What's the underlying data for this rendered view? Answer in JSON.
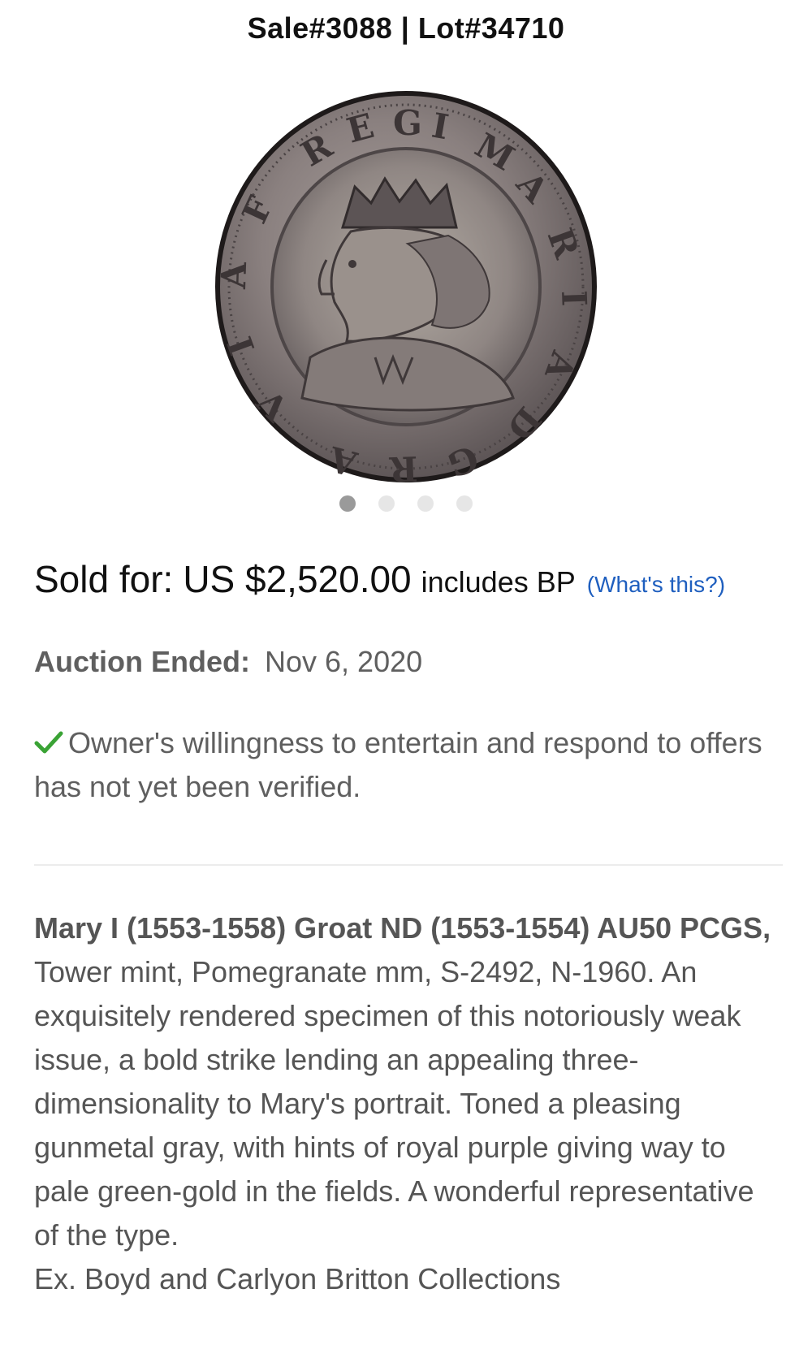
{
  "header": {
    "title": "Sale#3088 | Lot#34710"
  },
  "carousel": {
    "image_icon": "coin-photo",
    "dots": [
      {
        "active": true
      },
      {
        "active": false
      },
      {
        "active": false
      },
      {
        "active": false
      }
    ]
  },
  "price": {
    "label": "Sold for:",
    "amount": "US $2,520.00",
    "bp_note": "includes BP",
    "help_link": "(What's this?)"
  },
  "auction": {
    "ended_label": "Auction Ended:",
    "ended_date": "Nov 6, 2020"
  },
  "owner_notice": {
    "icon": "check-icon",
    "text": "Owner's willingness to entertain and respond to offers has not yet been verified."
  },
  "description": {
    "title": "Mary I (1553-1558) Groat ND (1553-1554) AU50 PCGS,",
    "body": " Tower mint, Pomegranate mm, S-2492, N-1960. An exquisitely rendered specimen of this notoriously weak issue, a bold strike lending an appealing three-dimensionality to Mary's portrait. Toned a pleasing gunmetal gray, with hints of royal purple giving way to pale green-gold in the fields. A wonderful representative of the type.",
    "provenance": "Ex. Boyd and Carlyon Britton Collections"
  },
  "colors": {
    "link": "#1f5fbf",
    "check": "#3aa335",
    "muted_text": "#5f5f5f"
  }
}
